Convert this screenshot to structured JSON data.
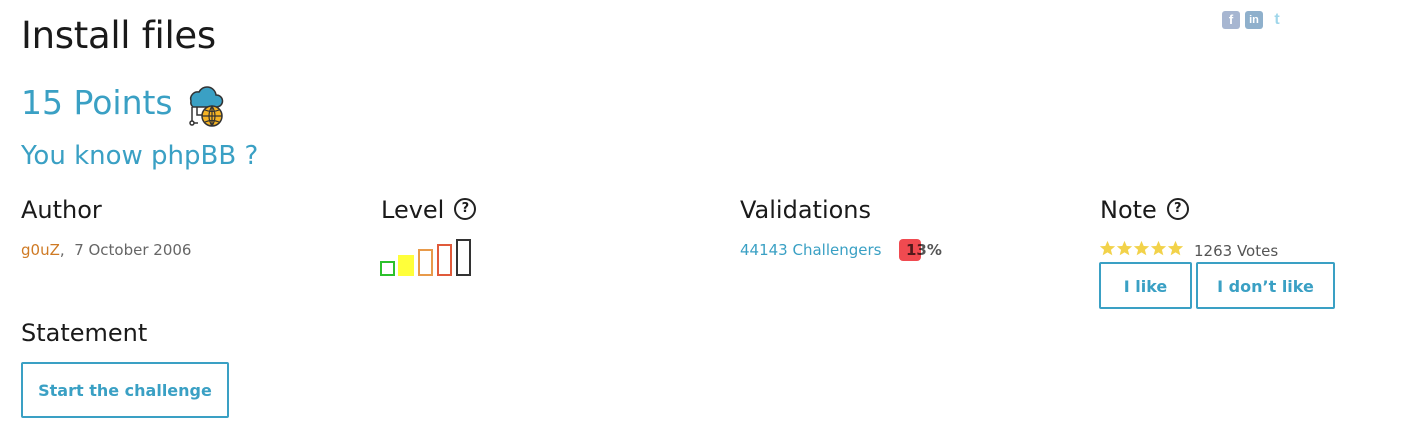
{
  "challenge": {
    "title": "Install files",
    "points": "15 Points",
    "subtitle": "You know phpBB ?"
  },
  "author": {
    "heading": "Author",
    "name": "g0uZ",
    "separator": ",",
    "date": "7 October 2006"
  },
  "level": {
    "heading": "Level",
    "help": "?",
    "value": 2,
    "max": 5,
    "colors": [
      "#2bc12b",
      "#ffff3a",
      "#e89a4a",
      "#e05a3a",
      "#333333"
    ]
  },
  "validations": {
    "heading": "Validations",
    "challengers": "44143 Challengers",
    "percent": "13%",
    "badge_color": "#f04a50"
  },
  "note": {
    "heading": "Note",
    "help": "?",
    "stars": 5,
    "votes": "1263 Votes",
    "like_label": "I like",
    "dislike_label": "I don’t like"
  },
  "statement": {
    "heading": "Statement",
    "start_label": "Start the challenge"
  },
  "social": {
    "facebook": "f",
    "linkedin": "in",
    "twitter": "t"
  },
  "colors": {
    "accent": "#3aa0c4",
    "author": "#cf7a24",
    "star": "#f2d24a"
  }
}
